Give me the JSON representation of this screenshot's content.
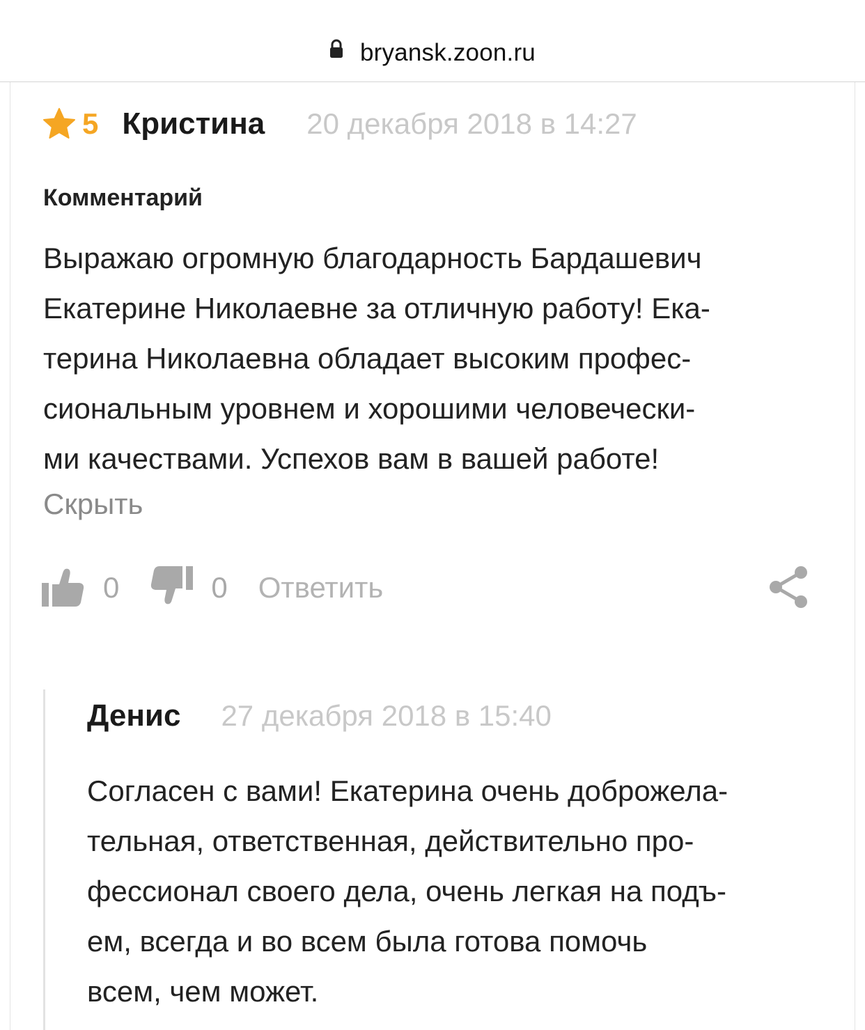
{
  "browser": {
    "url": "bryansk.zoon.ru"
  },
  "review": {
    "rating": "5",
    "author": "Кристина",
    "date": "20 декабря 2018 в 14:27",
    "comment_label": "Комментарий",
    "comment_lines": [
      "Выражаю огромную благодарность Бардашевич",
      "Екатерине Николаевне за отличную работу! Ека-",
      "терина Николаевна обладает высоким профес-",
      "сиональным уровнем и хорошими человечески-",
      "ми качествами. Успехов вам в вашей работе!"
    ],
    "hide_label": "Скрыть",
    "likes": "0",
    "dislikes": "0",
    "reply_label": "Ответить"
  },
  "reply": {
    "author": "Денис",
    "date": "27 декабря 2018 в 15:40",
    "lines": [
      "Согласен с вами! Екатерина очень доброжела-",
      "тельная, ответственная, действительно про-",
      "фессионал своего дела, очень легкая на подъ-",
      "ем, всегда и во всем была готова помочь",
      "всем, чем может."
    ]
  },
  "colors": {
    "accent_star": "#f5a623",
    "muted_text": "#c8c8c8",
    "icon_gray": "#a9a9a9"
  },
  "icons": [
    "lock-icon",
    "star-icon",
    "thumbs-up-icon",
    "thumbs-down-icon",
    "share-icon"
  ]
}
